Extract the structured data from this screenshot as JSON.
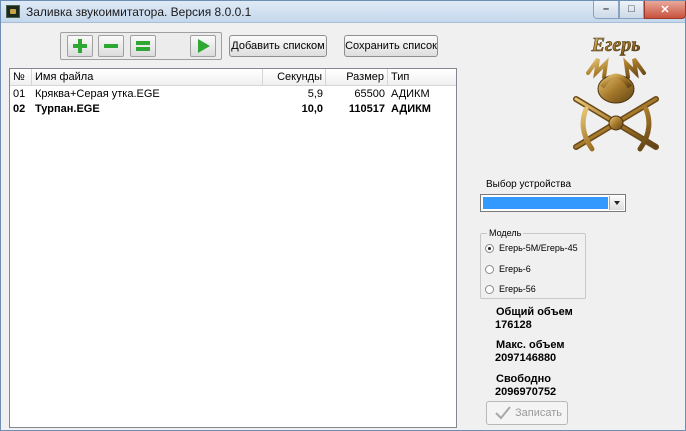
{
  "window": {
    "title": "Заливка звукоимитатора. Версия 8.0.0.1",
    "min_glyph": "–",
    "max_glyph": "□",
    "close_glyph": "✕"
  },
  "toolbar": {
    "add_list_label": "Добавить списком",
    "save_list_label": "Сохранить список",
    "icons": [
      "plus-icon",
      "minus-icon",
      "equal-icon",
      "play-icon"
    ],
    "icon_color": "#2ea832"
  },
  "file_list": {
    "columns": [
      "№",
      "Имя файла",
      "Секунды",
      "Размер",
      "Тип"
    ],
    "rows": [
      [
        "01",
        "Кряква+Серая утка.EGE",
        "5,9",
        "65500",
        "АДИКМ"
      ],
      [
        "02",
        "Турпан.EGE",
        "10,0",
        "110517",
        "АДИКМ"
      ]
    ]
  },
  "logo": {
    "text": "Егерь",
    "color": "#b8903c"
  },
  "device": {
    "label": "Выбор устройства",
    "selected": "",
    "highlight_color": "#3399ff"
  },
  "model": {
    "legend": "Модель",
    "options": [
      "Егерь-5М/Егерь-45",
      "Егерь-6",
      "Егерь-56"
    ],
    "selected_index": 0
  },
  "stats": {
    "total_label": "Общий объем",
    "total_value": "176128",
    "max_label": "Макс. объем",
    "max_value": "2097146880",
    "free_label": "Свободно",
    "free_value": "2096970752"
  },
  "write_button": {
    "label": "Записать",
    "enabled": false
  }
}
